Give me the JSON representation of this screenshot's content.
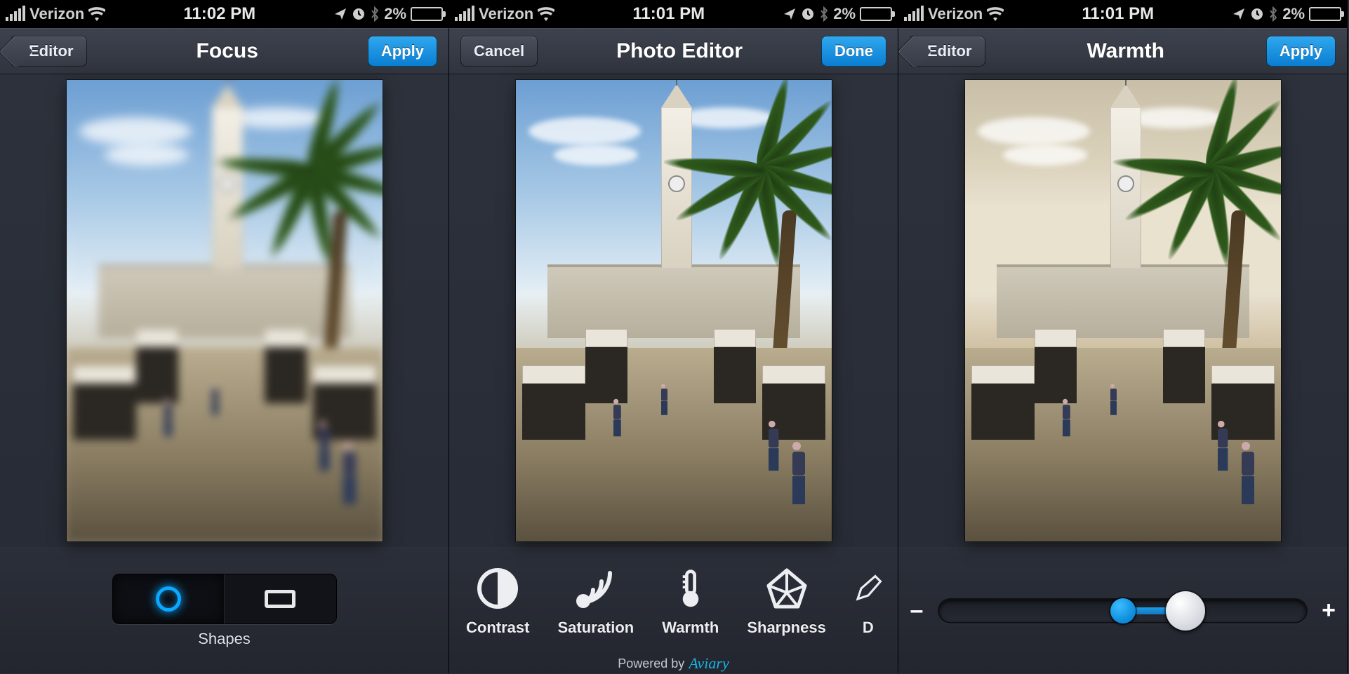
{
  "screens": [
    {
      "status": {
        "carrier": "Verizon",
        "time": "11:02 PM",
        "battery_pct": "2%"
      },
      "nav": {
        "left": "Editor",
        "title": "Focus",
        "right": "Apply",
        "left_style": "back",
        "right_style": "blue"
      },
      "photo_variant": "blurred",
      "toolbar": {
        "type": "shapes",
        "label": "Shapes",
        "selected_index": 0,
        "items": [
          "circle",
          "rectangle"
        ]
      }
    },
    {
      "status": {
        "carrier": "Verizon",
        "time": "11:01 PM",
        "battery_pct": "2%"
      },
      "nav": {
        "left": "Cancel",
        "title": "Photo Editor",
        "right": "Done",
        "left_style": "plain",
        "right_style": "blue"
      },
      "photo_variant": "normal",
      "toolbar": {
        "type": "tools",
        "tools": [
          {
            "id": "contrast",
            "label": "Contrast"
          },
          {
            "id": "saturation",
            "label": "Saturation"
          },
          {
            "id": "warmth",
            "label": "Warmth"
          },
          {
            "id": "sharpness",
            "label": "Sharpness"
          },
          {
            "id": "draw",
            "label": "D"
          }
        ],
        "footer_prefix": "Powered by",
        "footer_brand": "Aviary"
      }
    },
    {
      "status": {
        "carrier": "Verizon",
        "time": "11:01 PM",
        "battery_pct": "2%"
      },
      "nav": {
        "left": "Editor",
        "title": "Warmth",
        "right": "Apply",
        "left_style": "back",
        "right_style": "blue"
      },
      "photo_variant": "warm",
      "toolbar": {
        "type": "slider",
        "min_symbol": "–",
        "max_symbol": "+",
        "value_pct": 67
      }
    }
  ]
}
